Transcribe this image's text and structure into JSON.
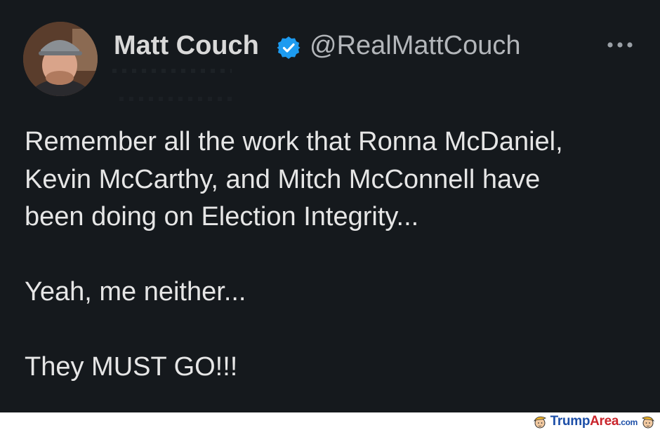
{
  "tweet": {
    "author": {
      "display_name": "Matt Couch",
      "handle": "@RealMattCouch",
      "verified": true,
      "avatar_icon": "profile-photo"
    },
    "more_icon": "more-horizontal-icon",
    "lines": [
      "Remember all the work that Ronna McDaniel,",
      "Kevin McCarthy, and Mitch McConnell have",
      "been doing on Election Integrity...",
      "",
      "Yeah, me neither...",
      "",
      "They MUST GO!!!"
    ]
  },
  "watermark": {
    "brand_main": "Trump",
    "brand_accent": "Area",
    "tld": ".com"
  },
  "colors": {
    "background": "#15191d",
    "text": "#e6e6e6",
    "handle": "#b3b6ba",
    "verified": "#1d9bf0",
    "watermark_blue": "#1d4fa8",
    "watermark_red": "#c9242b"
  }
}
